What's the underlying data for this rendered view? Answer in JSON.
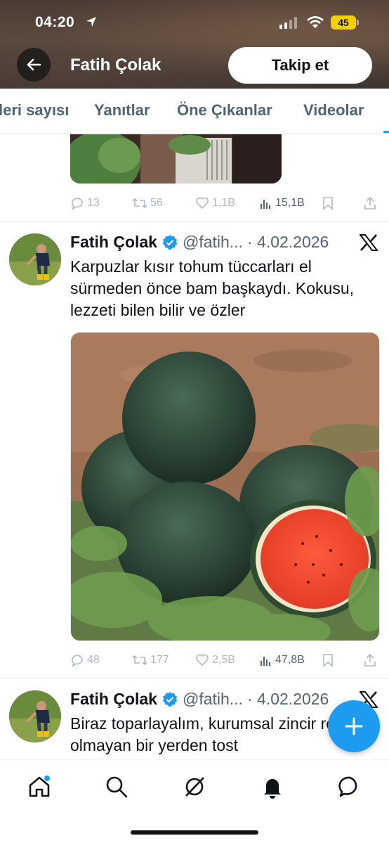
{
  "status_bar": {
    "time": "04:20",
    "battery": "45"
  },
  "header": {
    "name": "Fatih Çolak",
    "follow_label": "Takip et"
  },
  "tabs": [
    {
      "label": "leri sayısı"
    },
    {
      "label": "Yanıtlar"
    },
    {
      "label": "Öne Çıkanlar"
    },
    {
      "label": "Videolar"
    }
  ],
  "tweets": [
    {
      "stats": {
        "replies": "13",
        "retweets": "56",
        "likes": "1,1B",
        "views": "15,1B"
      }
    },
    {
      "name": "Fatih Çolak",
      "handle": "@fatih...",
      "date": "· 4.02.2026",
      "text": "Karpuzlar kısır tohum tüccarları el sürmeden önce bam başkaydı. Kokusu, lezzeti bilen bilir ve özler",
      "stats": {
        "replies": "48",
        "retweets": "177",
        "likes": "2,5B",
        "views": "47,8B"
      }
    },
    {
      "name": "Fatih Çolak",
      "handle": "@fatih...",
      "date": "· 4.02.2026",
      "text": "Biraz toparlayalım, kurumsal zincir restoran olmayan bir yerden tost"
    }
  ],
  "icons": {
    "back": "arrow-left-icon",
    "verified": "verified-badge-icon",
    "x": "x-logo-icon",
    "compose": "plus-icon",
    "nav": [
      "home-icon",
      "search-icon",
      "grok-icon",
      "notifications-icon",
      "messages-icon"
    ]
  },
  "colors": {
    "accent": "#1d9bf0",
    "muted": "#536471"
  }
}
